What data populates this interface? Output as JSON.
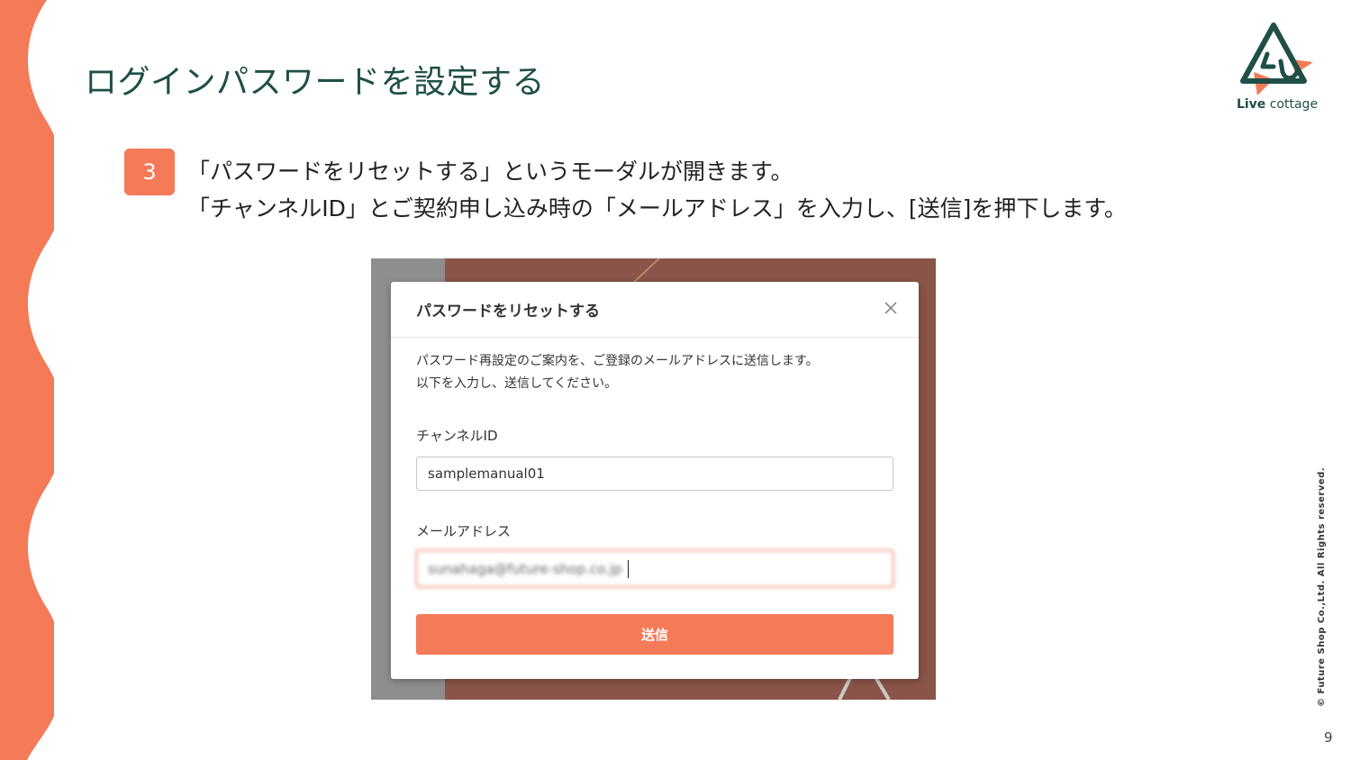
{
  "slide": {
    "title": "ログインパスワードを設定する",
    "page_number": "9",
    "copyright": "© Future Shop Co.,Ltd. All Rights reserved.",
    "logo": {
      "brand_bold": "Live",
      "brand_rest": " cottage"
    }
  },
  "step": {
    "number": "3",
    "lines": [
      "「パスワードをリセットする」というモーダルが開きます。",
      "「チャンネルID」とご契約申し込み時の「メールアドレス」を入力し、[送信]を押下します。"
    ]
  },
  "modal": {
    "title": "パスワードをリセットする",
    "description_lines": [
      "パスワード再設定のご案内を、ご登録のメールアドレスに送信します。",
      "以下を入力し、送信してください。"
    ],
    "channel_label": "チャンネルID",
    "channel_value": "samplemanual01",
    "email_label": "メールアドレス",
    "email_value": "sunahaga@future-shop.co.jp",
    "submit_label": "送信"
  },
  "colors": {
    "accent": "#f47a58",
    "title_green": "#1f4f46"
  }
}
